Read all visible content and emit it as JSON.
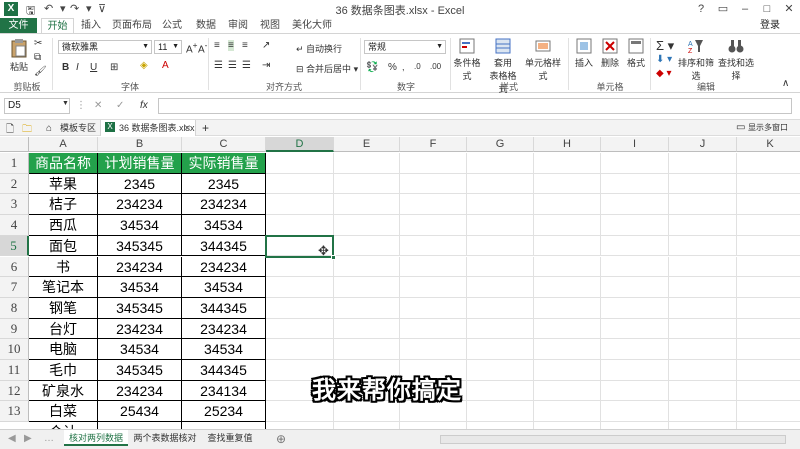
{
  "window": {
    "title": "36 数据条图表.xlsx - Excel",
    "help": "?",
    "login": "登录"
  },
  "ribbon_tabs": [
    "文件",
    "开始",
    "插入",
    "页面布局",
    "公式",
    "数据",
    "审阅",
    "视图",
    "美化大师"
  ],
  "ribbon": {
    "paste": "粘贴",
    "clipboard": "剪贴板",
    "font_name": "微软雅黑",
    "font_size": "11",
    "font_group": "字体",
    "bold": "B",
    "italic": "I",
    "underline": "U",
    "wrap_text": "自动换行",
    "merge_center": "合并后居中",
    "align_group": "对齐方式",
    "number_format": "常规",
    "percent": "%",
    "number_group": "数字",
    "cond_format": "条件格式",
    "table_format_1": "套用",
    "table_format_2": "表格格式",
    "cell_style": "单元格样式",
    "style_group": "样式",
    "insert": "插入",
    "delete": "删除",
    "format": "格式",
    "cells_group": "单元格",
    "sort_filter": "排序和筛选",
    "find_select": "查找和选择",
    "edit_group": "编辑"
  },
  "formula_bar": {
    "name_box": "D5",
    "fx": "fx",
    "cancel": "✕",
    "confirm": "✓",
    "content": ""
  },
  "workbook_tabs": {
    "template": "模板专区",
    "file": "36 数据条图表.xlsx",
    "add": "+",
    "show_multi": "显示多窗口"
  },
  "columns": [
    "A",
    "B",
    "C",
    "D",
    "E",
    "F",
    "G",
    "H",
    "I",
    "J",
    "K"
  ],
  "rows": [
    "1",
    "2",
    "3",
    "4",
    "5",
    "6",
    "7",
    "8",
    "9",
    "10",
    "11",
    "12",
    "13"
  ],
  "table": {
    "headers": [
      "商品名称",
      "计划销售量",
      "实际销售量"
    ],
    "rows": [
      [
        "苹果",
        "2345",
        "2345"
      ],
      [
        "桔子",
        "234234",
        "234234"
      ],
      [
        "西瓜",
        "34534",
        "34534"
      ],
      [
        "面包",
        "345345",
        "344345"
      ],
      [
        "书",
        "234234",
        "234234"
      ],
      [
        "笔记本",
        "34534",
        "34534"
      ],
      [
        "钢笔",
        "345345",
        "344345"
      ],
      [
        "台灯",
        "234234",
        "234234"
      ],
      [
        "电脑",
        "34534",
        "34534"
      ],
      [
        "毛巾",
        "345345",
        "344345"
      ],
      [
        "矿泉水",
        "234234",
        "234134"
      ],
      [
        "白菜",
        "25434",
        "25234"
      ]
    ],
    "partial_row": "合计"
  },
  "sheet_tabs": [
    "核对两列数据",
    "两个表数据核对",
    "查找重复值"
  ],
  "sheet_add": "⊕",
  "subtitle": "我来帮你搞定",
  "colors": {
    "accent": "#217346",
    "header_fill": "#23a14b"
  }
}
